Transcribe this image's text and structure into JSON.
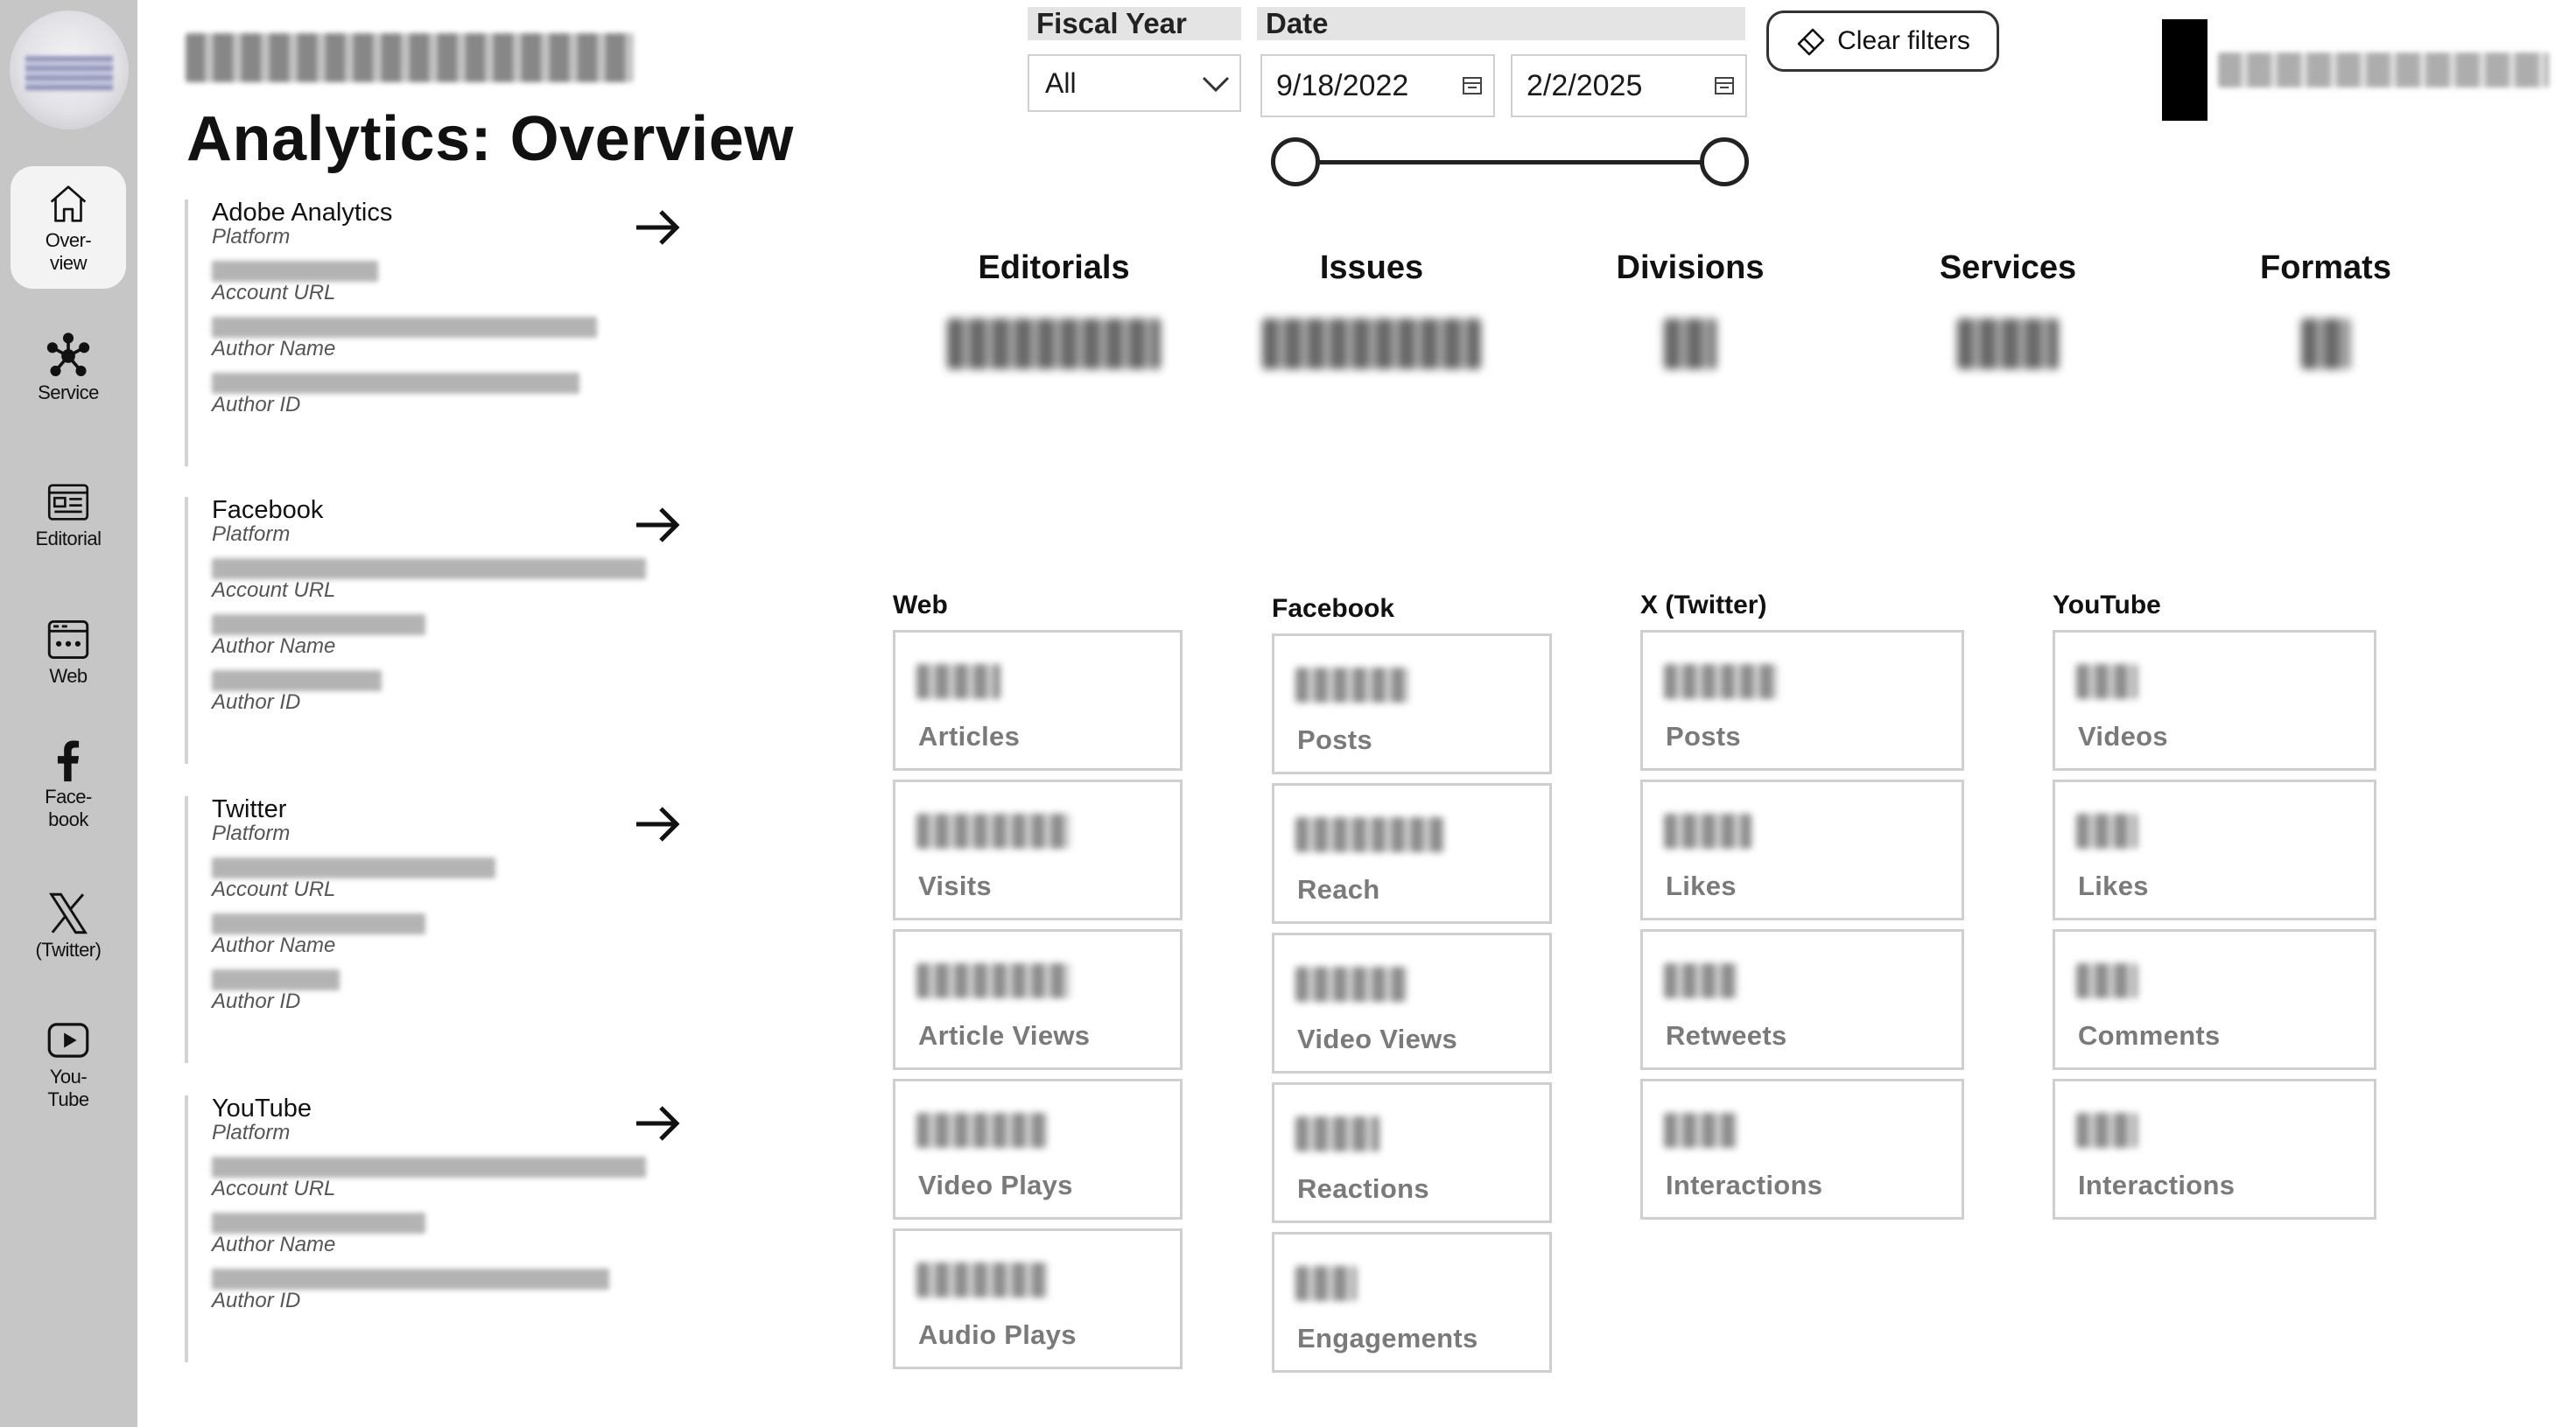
{
  "header": {
    "title": "Analytics: Overview"
  },
  "nav": [
    {
      "id": "overview",
      "label": "Over-\nview",
      "icon": "home-icon",
      "active": true
    },
    {
      "id": "service",
      "label": "Service",
      "icon": "network-icon",
      "active": false
    },
    {
      "id": "editorial",
      "label": "Editorial",
      "icon": "newspaper-icon",
      "active": false
    },
    {
      "id": "web",
      "label": "Web",
      "icon": "browser-icon",
      "active": false
    },
    {
      "id": "facebook",
      "label": "Face-\nbook",
      "icon": "facebook-icon",
      "active": false
    },
    {
      "id": "twitter",
      "label": "(Twitter)",
      "icon": "x-logo-icon",
      "active": false
    },
    {
      "id": "youtube",
      "label": "You-\nTube",
      "icon": "play-icon",
      "active": false
    }
  ],
  "filters": {
    "fiscal_year_label": "Fiscal Year",
    "fiscal_year_value": "All",
    "date_label": "Date",
    "date_start": "9/18/2022",
    "date_end": "2/2/2025",
    "clear_label": "Clear filters"
  },
  "platforms": [
    {
      "name": "Adobe Analytics",
      "sub_platform": "Platform",
      "f1": "Account URL",
      "f2": "Author Name",
      "f3": "Author ID"
    },
    {
      "name": "Facebook",
      "sub_platform": "Platform",
      "f1": "Account URL",
      "f2": "Author Name",
      "f3": "Author ID"
    },
    {
      "name": "Twitter",
      "sub_platform": "Platform",
      "f1": "Account URL",
      "f2": "Author Name",
      "f3": "Author ID"
    },
    {
      "name": "YouTube",
      "sub_platform": "Platform",
      "f1": "Account URL",
      "f2": "Author Name",
      "f3": "Author ID"
    }
  ],
  "kpis": [
    {
      "label": "Editorials"
    },
    {
      "label": "Issues"
    },
    {
      "label": "Divisions"
    },
    {
      "label": "Services"
    },
    {
      "label": "Formats"
    }
  ],
  "columns": {
    "web": {
      "title": "Web",
      "cards": [
        "Articles",
        "Visits",
        "Article Views",
        "Video Plays",
        "Audio Plays"
      ]
    },
    "facebook": {
      "title": "Facebook",
      "cards": [
        "Posts",
        "Reach",
        "Video Views",
        "Reactions",
        "Engagements"
      ]
    },
    "x": {
      "title": "X (Twitter)",
      "cards": [
        "Posts",
        "Likes",
        "Retweets",
        "Interactions"
      ]
    },
    "youtube": {
      "title": "YouTube",
      "cards": [
        "Videos",
        "Likes",
        "Comments",
        "Interactions"
      ]
    }
  }
}
